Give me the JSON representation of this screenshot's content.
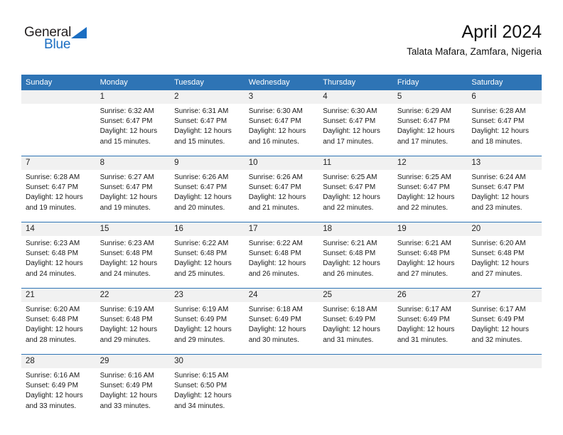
{
  "brand": {
    "name_part1": "General",
    "name_part2": "Blue",
    "accent_color": "#1b6ec2"
  },
  "header": {
    "month_title": "April 2024",
    "location": "Talata Mafara, Zamfara, Nigeria"
  },
  "theme": {
    "header_blue": "#2e74b5",
    "daynum_gray": "#f1f1f1"
  },
  "calendar": {
    "weekday_headers": [
      "Sunday",
      "Monday",
      "Tuesday",
      "Wednesday",
      "Thursday",
      "Friday",
      "Saturday"
    ],
    "weeks": [
      [
        {
          "day": "",
          "sunrise": "",
          "sunset": "",
          "daylight_line1": "",
          "daylight_line2": ""
        },
        {
          "day": "1",
          "sunrise": "Sunrise: 6:32 AM",
          "sunset": "Sunset: 6:47 PM",
          "daylight_line1": "Daylight: 12 hours",
          "daylight_line2": "and 15 minutes."
        },
        {
          "day": "2",
          "sunrise": "Sunrise: 6:31 AM",
          "sunset": "Sunset: 6:47 PM",
          "daylight_line1": "Daylight: 12 hours",
          "daylight_line2": "and 15 minutes."
        },
        {
          "day": "3",
          "sunrise": "Sunrise: 6:30 AM",
          "sunset": "Sunset: 6:47 PM",
          "daylight_line1": "Daylight: 12 hours",
          "daylight_line2": "and 16 minutes."
        },
        {
          "day": "4",
          "sunrise": "Sunrise: 6:30 AM",
          "sunset": "Sunset: 6:47 PM",
          "daylight_line1": "Daylight: 12 hours",
          "daylight_line2": "and 17 minutes."
        },
        {
          "day": "5",
          "sunrise": "Sunrise: 6:29 AM",
          "sunset": "Sunset: 6:47 PM",
          "daylight_line1": "Daylight: 12 hours",
          "daylight_line2": "and 17 minutes."
        },
        {
          "day": "6",
          "sunrise": "Sunrise: 6:28 AM",
          "sunset": "Sunset: 6:47 PM",
          "daylight_line1": "Daylight: 12 hours",
          "daylight_line2": "and 18 minutes."
        }
      ],
      [
        {
          "day": "7",
          "sunrise": "Sunrise: 6:28 AM",
          "sunset": "Sunset: 6:47 PM",
          "daylight_line1": "Daylight: 12 hours",
          "daylight_line2": "and 19 minutes."
        },
        {
          "day": "8",
          "sunrise": "Sunrise: 6:27 AM",
          "sunset": "Sunset: 6:47 PM",
          "daylight_line1": "Daylight: 12 hours",
          "daylight_line2": "and 19 minutes."
        },
        {
          "day": "9",
          "sunrise": "Sunrise: 6:26 AM",
          "sunset": "Sunset: 6:47 PM",
          "daylight_line1": "Daylight: 12 hours",
          "daylight_line2": "and 20 minutes."
        },
        {
          "day": "10",
          "sunrise": "Sunrise: 6:26 AM",
          "sunset": "Sunset: 6:47 PM",
          "daylight_line1": "Daylight: 12 hours",
          "daylight_line2": "and 21 minutes."
        },
        {
          "day": "11",
          "sunrise": "Sunrise: 6:25 AM",
          "sunset": "Sunset: 6:47 PM",
          "daylight_line1": "Daylight: 12 hours",
          "daylight_line2": "and 22 minutes."
        },
        {
          "day": "12",
          "sunrise": "Sunrise: 6:25 AM",
          "sunset": "Sunset: 6:47 PM",
          "daylight_line1": "Daylight: 12 hours",
          "daylight_line2": "and 22 minutes."
        },
        {
          "day": "13",
          "sunrise": "Sunrise: 6:24 AM",
          "sunset": "Sunset: 6:47 PM",
          "daylight_line1": "Daylight: 12 hours",
          "daylight_line2": "and 23 minutes."
        }
      ],
      [
        {
          "day": "14",
          "sunrise": "Sunrise: 6:23 AM",
          "sunset": "Sunset: 6:48 PM",
          "daylight_line1": "Daylight: 12 hours",
          "daylight_line2": "and 24 minutes."
        },
        {
          "day": "15",
          "sunrise": "Sunrise: 6:23 AM",
          "sunset": "Sunset: 6:48 PM",
          "daylight_line1": "Daylight: 12 hours",
          "daylight_line2": "and 24 minutes."
        },
        {
          "day": "16",
          "sunrise": "Sunrise: 6:22 AM",
          "sunset": "Sunset: 6:48 PM",
          "daylight_line1": "Daylight: 12 hours",
          "daylight_line2": "and 25 minutes."
        },
        {
          "day": "17",
          "sunrise": "Sunrise: 6:22 AM",
          "sunset": "Sunset: 6:48 PM",
          "daylight_line1": "Daylight: 12 hours",
          "daylight_line2": "and 26 minutes."
        },
        {
          "day": "18",
          "sunrise": "Sunrise: 6:21 AM",
          "sunset": "Sunset: 6:48 PM",
          "daylight_line1": "Daylight: 12 hours",
          "daylight_line2": "and 26 minutes."
        },
        {
          "day": "19",
          "sunrise": "Sunrise: 6:21 AM",
          "sunset": "Sunset: 6:48 PM",
          "daylight_line1": "Daylight: 12 hours",
          "daylight_line2": "and 27 minutes."
        },
        {
          "day": "20",
          "sunrise": "Sunrise: 6:20 AM",
          "sunset": "Sunset: 6:48 PM",
          "daylight_line1": "Daylight: 12 hours",
          "daylight_line2": "and 27 minutes."
        }
      ],
      [
        {
          "day": "21",
          "sunrise": "Sunrise: 6:20 AM",
          "sunset": "Sunset: 6:48 PM",
          "daylight_line1": "Daylight: 12 hours",
          "daylight_line2": "and 28 minutes."
        },
        {
          "day": "22",
          "sunrise": "Sunrise: 6:19 AM",
          "sunset": "Sunset: 6:48 PM",
          "daylight_line1": "Daylight: 12 hours",
          "daylight_line2": "and 29 minutes."
        },
        {
          "day": "23",
          "sunrise": "Sunrise: 6:19 AM",
          "sunset": "Sunset: 6:49 PM",
          "daylight_line1": "Daylight: 12 hours",
          "daylight_line2": "and 29 minutes."
        },
        {
          "day": "24",
          "sunrise": "Sunrise: 6:18 AM",
          "sunset": "Sunset: 6:49 PM",
          "daylight_line1": "Daylight: 12 hours",
          "daylight_line2": "and 30 minutes."
        },
        {
          "day": "25",
          "sunrise": "Sunrise: 6:18 AM",
          "sunset": "Sunset: 6:49 PM",
          "daylight_line1": "Daylight: 12 hours",
          "daylight_line2": "and 31 minutes."
        },
        {
          "day": "26",
          "sunrise": "Sunrise: 6:17 AM",
          "sunset": "Sunset: 6:49 PM",
          "daylight_line1": "Daylight: 12 hours",
          "daylight_line2": "and 31 minutes."
        },
        {
          "day": "27",
          "sunrise": "Sunrise: 6:17 AM",
          "sunset": "Sunset: 6:49 PM",
          "daylight_line1": "Daylight: 12 hours",
          "daylight_line2": "and 32 minutes."
        }
      ],
      [
        {
          "day": "28",
          "sunrise": "Sunrise: 6:16 AM",
          "sunset": "Sunset: 6:49 PM",
          "daylight_line1": "Daylight: 12 hours",
          "daylight_line2": "and 33 minutes."
        },
        {
          "day": "29",
          "sunrise": "Sunrise: 6:16 AM",
          "sunset": "Sunset: 6:49 PM",
          "daylight_line1": "Daylight: 12 hours",
          "daylight_line2": "and 33 minutes."
        },
        {
          "day": "30",
          "sunrise": "Sunrise: 6:15 AM",
          "sunset": "Sunset: 6:50 PM",
          "daylight_line1": "Daylight: 12 hours",
          "daylight_line2": "and 34 minutes."
        },
        {
          "day": "",
          "sunrise": "",
          "sunset": "",
          "daylight_line1": "",
          "daylight_line2": ""
        },
        {
          "day": "",
          "sunrise": "",
          "sunset": "",
          "daylight_line1": "",
          "daylight_line2": ""
        },
        {
          "day": "",
          "sunrise": "",
          "sunset": "",
          "daylight_line1": "",
          "daylight_line2": ""
        },
        {
          "day": "",
          "sunrise": "",
          "sunset": "",
          "daylight_line1": "",
          "daylight_line2": ""
        }
      ]
    ]
  }
}
